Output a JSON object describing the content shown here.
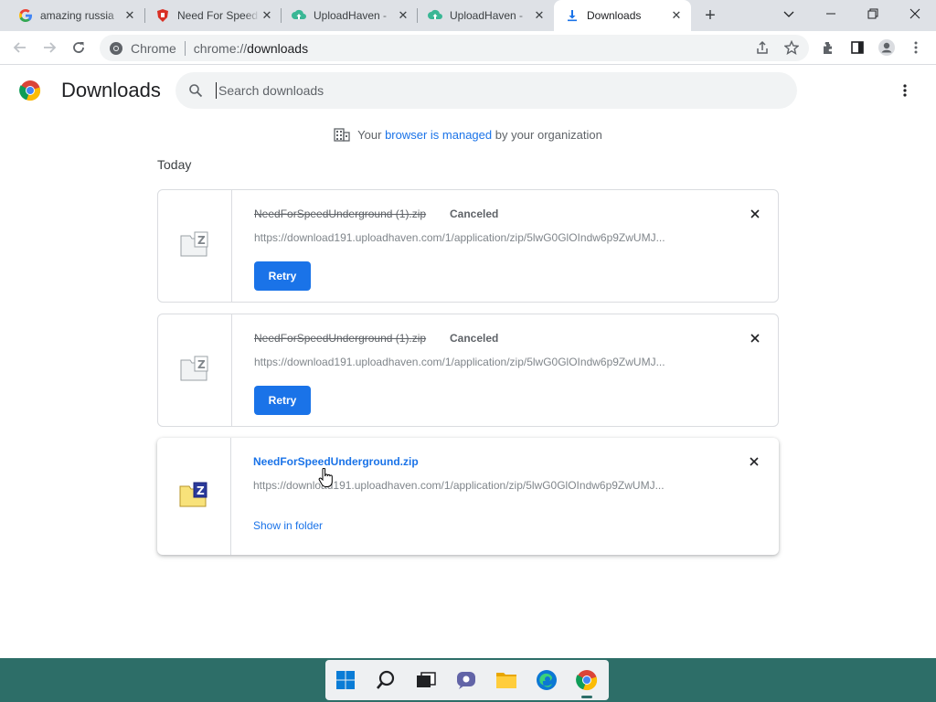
{
  "browser": {
    "tabs": [
      {
        "title": "amazing russia",
        "icon": "google-favicon",
        "active": false
      },
      {
        "title": "Need For Speed",
        "icon": "red-shield-favicon",
        "active": false
      },
      {
        "title": "UploadHaven -",
        "icon": "uploadhaven-favicon",
        "active": false
      },
      {
        "title": "UploadHaven -",
        "icon": "uploadhaven-favicon",
        "active": false
      },
      {
        "title": "Downloads",
        "icon": "download-favicon",
        "active": true
      }
    ],
    "new_tab_label": "+",
    "omnibox": {
      "chip": "Chrome",
      "url_scheme": "chrome://",
      "url_path": "downloads"
    }
  },
  "page": {
    "title": "Downloads",
    "search_placeholder": "Search downloads",
    "managed_notice": {
      "prefix": "Your ",
      "link": "browser is managed",
      "suffix": " by your organization"
    },
    "section_label": "Today"
  },
  "downloads": [
    {
      "filename": "NeedForSpeedUnderground (1).zip",
      "status": "Canceled",
      "url": "https://download191.uploadhaven.com/1/application/zip/5lwG0GlOIndw6p9ZwUMJ...",
      "action": "Retry",
      "state": "canceled"
    },
    {
      "filename": "NeedForSpeedUnderground (1).zip",
      "status": "Canceled",
      "url": "https://download191.uploadhaven.com/1/application/zip/5lwG0GlOIndw6p9ZwUMJ...",
      "action": "Retry",
      "state": "canceled"
    },
    {
      "filename": "NeedForSpeedUnderground.zip",
      "status": "",
      "url": "https://download191.uploadhaven.com/1/application/zip/5lwG0GlOIndw6p9ZwUMJ...",
      "action": "Show in folder",
      "state": "complete"
    }
  ],
  "taskbar": {
    "apps": [
      "start-icon",
      "search-icon",
      "task-view-icon",
      "chat-icon",
      "file-explorer-icon",
      "edge-icon",
      "chrome-icon"
    ],
    "active_app": "chrome-icon"
  },
  "colors": {
    "accent": "#1a73e8",
    "taskbar": "#2d6e68",
    "tabstrip": "#dee1e6"
  }
}
